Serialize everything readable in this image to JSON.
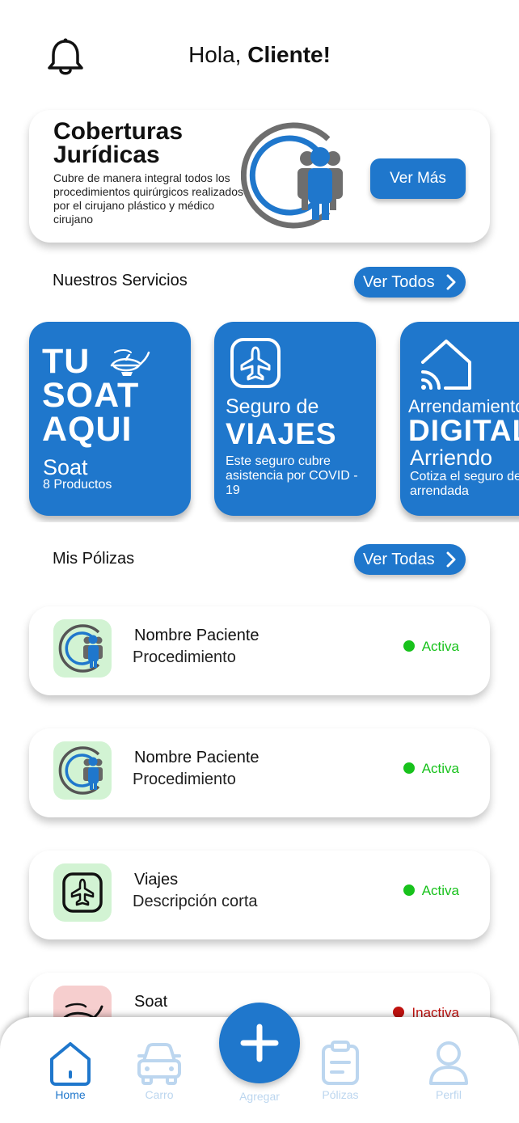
{
  "header": {
    "greeting_prefix": "Hola, ",
    "greeting_name": "Cliente!"
  },
  "hero": {
    "title": "Coberturas Jurídicas",
    "description": "Cubre de manera integral todos los procedimientos quirúrgicos realizados por el cirujano plástico y médico cirujano",
    "button_label": "Ver Más"
  },
  "services_section": {
    "title": "Nuestros Servicios",
    "button_label": "Ver Todos"
  },
  "services": [
    {
      "big_text": "TU SOAT AQUI",
      "name": "Soat",
      "detail": "8 Productos",
      "icon": "lamp-icon"
    },
    {
      "line1": "Seguro de",
      "big_text": "VIAJES",
      "detail": "Este seguro cubre asistencia por COVID - 19",
      "icon": "airplane-icon"
    },
    {
      "line1": "Arrendamiento",
      "big_text": "DIGITAL",
      "name": "Arriendo",
      "detail": "Cotiza el seguro de tu vivienda arrendada",
      "icon": "smart-home-icon"
    }
  ],
  "policies_section": {
    "title": "Mis Pólizas",
    "button_label": "Ver Todas"
  },
  "policies": [
    {
      "name": "Nombre Paciente",
      "description": "Procedimiento",
      "status": "Activa",
      "icon": "coverage-logo-icon"
    },
    {
      "name": "Nombre Paciente",
      "description": "Procedimiento",
      "status": "Activa",
      "icon": "coverage-logo-icon"
    },
    {
      "name": "Viajes",
      "description": "Descripción corta",
      "status": "Activa",
      "icon": "airplane-icon"
    },
    {
      "name": "Soat",
      "description": "",
      "status": "Inactiva",
      "icon": "lamp-icon"
    }
  ],
  "tabbar": {
    "items": [
      {
        "label": "Home",
        "icon": "home-icon",
        "active": true
      },
      {
        "label": "Carro",
        "icon": "car-icon",
        "active": false
      },
      {
        "label": "Agregar",
        "icon": "plus-icon",
        "active": false
      },
      {
        "label": "Pólizas",
        "icon": "clipboard-icon",
        "active": false
      },
      {
        "label": "Perfil",
        "icon": "user-icon",
        "active": false
      }
    ]
  },
  "colors": {
    "primary": "#1f77cc",
    "active_status": "#18c21c",
    "inactive_status": "#c0120f",
    "icon_bg_green": "#d2f3d3",
    "icon_bg_red": "#f6cece",
    "tab_inactive": "#bcd6ef"
  }
}
